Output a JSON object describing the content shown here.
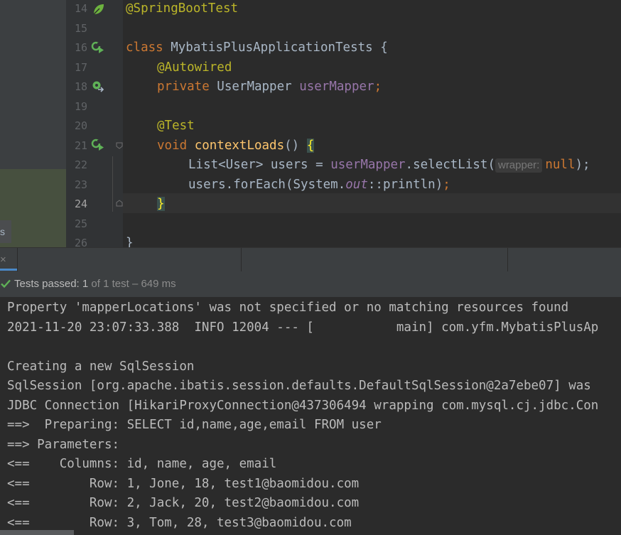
{
  "project_panel": {
    "fragment_text": "s"
  },
  "editor": {
    "line_numbers": [
      "14",
      "15",
      "16",
      "17",
      "18",
      "19",
      "20",
      "21",
      "22",
      "23",
      "24",
      "25",
      "26"
    ],
    "code": {
      "l14": "@SpringBootTest",
      "l16_kw": "class",
      "l16_name": " MybatisPlusApplicationTests ",
      "l16_brace": "{",
      "l17": "@Autowired",
      "l18_kw": "private",
      "l18_type": " UserMapper ",
      "l18_field": "userMapper",
      "l18_semi": ";",
      "l20": "@Test",
      "l21_kw": "void",
      "l21_fn": "contextLoads",
      "l21_parens": "() ",
      "l21_brace": "{",
      "l22_a": "List<User> users = ",
      "l22_field": "userMapper",
      "l22_b": ".selectList(",
      "l22_hint": "wrapper:",
      "l22_null": "null",
      "l22_c": ");",
      "l23_a": "users.forEach(System.",
      "l23_static": "out",
      "l23_b": "::println)",
      "l23_semi": ";",
      "l24_brace": "}",
      "l26_brace": "}"
    }
  },
  "run_panel": {
    "close_glyph": "×",
    "status": {
      "passed_label": "Tests passed:",
      "passed_count": "1",
      "detail": "of 1 test – 649 ms"
    },
    "console_lines": [
      "Property 'mapperLocations' was not specified or no matching resources found",
      "2021-11-20 23:07:33.388  INFO 12004 --- [           main] com.yfm.MybatisPlusAp",
      "",
      "Creating a new SqlSession",
      "SqlSession [org.apache.ibatis.session.defaults.DefaultSqlSession@2a7ebe07] was",
      "JDBC Connection [HikariProxyConnection@437306494 wrapping com.mysql.cj.jdbc.Con",
      "==>  Preparing: SELECT id,name,age,email FROM user",
      "==> Parameters: ",
      "<==    Columns: id, name, age, email",
      "<==        Row: 1, Jone, 18, test1@baomidou.com",
      "<==        Row: 2, Jack, 20, test2@baomidou.com",
      "<==        Row: 3, Tom, 28, test3@baomidou.com"
    ]
  },
  "colors": {
    "keyword": "#cc7832",
    "annotation": "#bbb529",
    "field": "#9876aa",
    "function": "#ffc66d",
    "pass": "#5fb157"
  }
}
